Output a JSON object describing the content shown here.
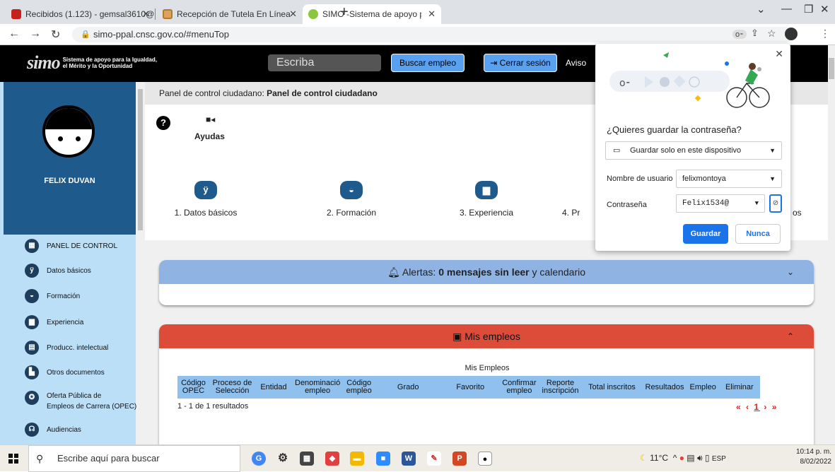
{
  "browser": {
    "tabs": [
      {
        "label": "Recibidos (1.123) - gemsal3610@",
        "favicon_color": "#c5221f"
      },
      {
        "label": "Recepción de Tutela En Línea",
        "favicon_color": "#b07b2a"
      },
      {
        "label": "SIMO -Sistema de apoyo para la",
        "favicon_color": "#8cc63f"
      }
    ],
    "url": "simo-ppal.cnsc.gov.co/#menuTop"
  },
  "site": {
    "logo_text": "simo",
    "logo_tagline": "Sistema de apoyo para la Igualdad, el Mérito y la Oportunidad",
    "search_placeholder": "Escriba",
    "search_button": "Buscar empleo",
    "logout_button": "Cerrar sesión",
    "avisos": "Aviso"
  },
  "sidebar": {
    "user_name": "FELIX DUVAN",
    "items": [
      {
        "label": "PANEL DE CONTROL",
        "icon": "grid-icon"
      },
      {
        "label": "Datos básicos",
        "icon": "people-icon"
      },
      {
        "label": "Formación",
        "icon": "book-icon"
      },
      {
        "label": "Experiencia",
        "icon": "briefcase-icon"
      },
      {
        "label": "Producc. intelectual",
        "icon": "document-icon"
      },
      {
        "label": "Otros documentos",
        "icon": "file-icon"
      },
      {
        "label": "Oferta Pública de",
        "label2": "Empleos de Carrera (OPEC)",
        "icon": "globe-icon"
      },
      {
        "label": "Audiencias",
        "icon": "audience-icon"
      }
    ]
  },
  "main": {
    "breadcrumb_prefix": "Panel de control ciudadano: ",
    "breadcrumb_bold": "Panel de control ciudadano",
    "help_label": "Ayudas",
    "steps": [
      {
        "label": "1. Datos básicos",
        "icon": "people-icon"
      },
      {
        "label": "2. Formación",
        "icon": "book-icon"
      },
      {
        "label": "3. Experiencia",
        "icon": "briefcase-icon"
      },
      {
        "label": "4. Pr",
        "icon": "document-icon"
      }
    ],
    "step5_tail": "os",
    "alerts": {
      "prefix": "Alertas: ",
      "bold": "0 mensajes sin leer",
      "suffix": " y calendario",
      "color": "#8fb4e3"
    },
    "jobs": {
      "title": "Mis empleos",
      "color": "#dd4b39",
      "table_title": "Mis Empleos",
      "columns": [
        "Código OPEC",
        "Proceso de Selección",
        "Entidad",
        "Denominació empleo",
        "Código empleo",
        "Grado",
        "Favorito",
        "Confirmar empleo",
        "Reporte inscripción",
        "Total inscritos",
        "Resultados",
        "Empleo",
        "Eliminar"
      ],
      "results_text": "1 - 1 de 1 resultados",
      "pager": {
        "first": "«",
        "prev": "‹",
        "page": "1",
        "next": "›",
        "last": "»"
      }
    }
  },
  "password_popup": {
    "title": "¿Quieres guardar la contraseña?",
    "save_location": "Guardar solo en este dispositivo",
    "username_label": "Nombre de usuario",
    "username_value": "felixmontoya",
    "password_label": "Contraseña",
    "password_value": "Felix1534@",
    "save_button": "Guardar",
    "never_button": "Nunca"
  },
  "taskbar": {
    "search_placeholder": "Escribe aquí para buscar",
    "weather": "11°C",
    "language": "ESP",
    "time": "10:14 p. m.",
    "date": "8/02/2022"
  }
}
